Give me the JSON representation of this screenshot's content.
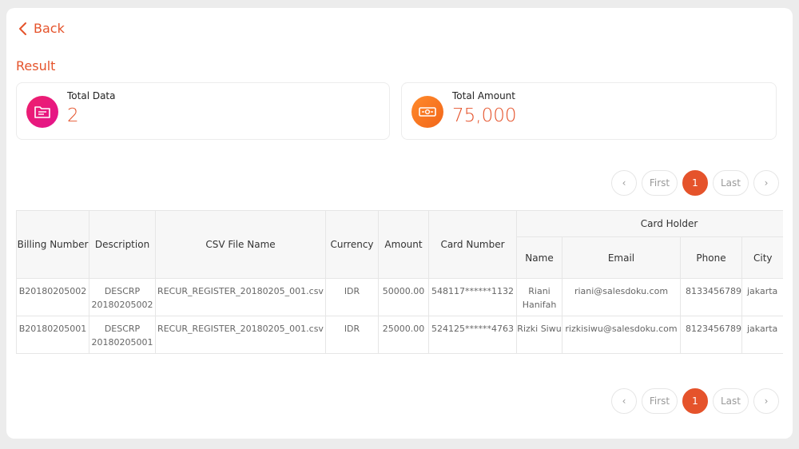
{
  "nav": {
    "back_label": "Back"
  },
  "result": {
    "title": "Result"
  },
  "stats": [
    {
      "label": "Total Data",
      "value": "2",
      "icon": "document-icon",
      "color": "#e91e7a"
    },
    {
      "label": "Total Amount",
      "value": "75,000",
      "icon": "money-icon",
      "color": "#f57c22"
    }
  ],
  "pagination": {
    "prev": "‹",
    "first": "First",
    "current": "1",
    "last": "Last",
    "next": "›"
  },
  "table": {
    "headers": {
      "billing_number": "Billing Number",
      "description": "Description",
      "csv_file_name": "CSV File Name",
      "currency": "Currency",
      "amount": "Amount",
      "card_number": "Card Number",
      "card_holder": "Card Holder",
      "name": "Name",
      "email": "Email",
      "phone": "Phone",
      "city": "City"
    },
    "rows": [
      {
        "billing_number": "B20180205002",
        "description": "DESCRP 20180205002",
        "csv_file_name": "RECUR_REGISTER_20180205_001.csv",
        "currency": "IDR",
        "amount": "50000.00",
        "card_number": "548117******1132",
        "name": "Riani Hanifah",
        "email": "riani@salesdoku.com",
        "phone": "8133456789",
        "city": "jakarta"
      },
      {
        "billing_number": "B20180205001",
        "description": "DESCRP 20180205001",
        "csv_file_name": "RECUR_REGISTER_20180205_001.csv",
        "currency": "IDR",
        "amount": "25000.00",
        "card_number": "524125******4763",
        "name": "Rizki Siwu",
        "email": "rizkisiwu@salesdoku.com",
        "phone": "8123456789",
        "city": "jakarta"
      }
    ]
  },
  "colors": {
    "accent": "#e5532b",
    "background": "#ececec"
  }
}
